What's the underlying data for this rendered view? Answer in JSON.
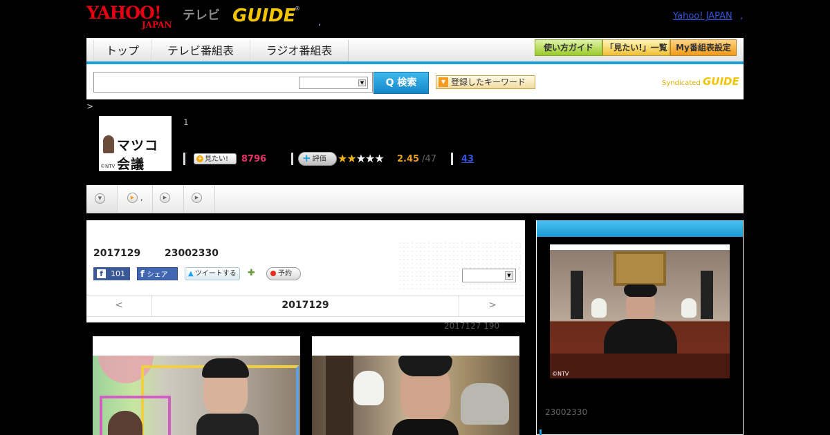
{
  "header": {
    "logo_yahoo_top": "YAHOO!",
    "logo_yahoo_bottom": "JAPAN",
    "logo_tv": "テレビ",
    "logo_gguide": "GUIDE",
    "header_dot": ",",
    "yahoo_japan_link": "Yahoo! JAPAN",
    "header_comma": ","
  },
  "nav": {
    "tabs": [
      {
        "label": "トップ"
      },
      {
        "label": "テレビ番組表"
      },
      {
        "label": "ラジオ番組表"
      }
    ],
    "buttons": {
      "guide": "使い方ガイド",
      "mitai_list": "「見たい!」一覧",
      "my_guide": "My番組表設定"
    }
  },
  "search": {
    "input_value": "",
    "button_label": "Q 検索",
    "keyword_button": "登録したキーワード",
    "syndicated_text": "Syndicated",
    "syndicated_logo": "GUIDE"
  },
  "breadcrumb": ">",
  "program": {
    "thumb_title": "マツコ会議",
    "thumb_copyright": "©NTV",
    "header_text": "1",
    "mitai_label": "見たい!",
    "mitai_count": "8796",
    "hyoka_label": "評価",
    "rating": 2.45,
    "rating_score": "2.45",
    "rating_count": "/47",
    "review_count": "43"
  },
  "subtabs": {
    "tab2_label": ","
  },
  "episode": {
    "date": "2017129",
    "time": "23002330",
    "like_count": "101",
    "share_label": "シェア",
    "tweet_label": "ツイートする",
    "reserve_label": "予約",
    "nav_prev": "<",
    "nav_date": "2017129",
    "nav_next": ">",
    "count_note": "2017127  190"
  },
  "panel": {
    "photo_copyright": "©NTV",
    "time": "23002330"
  },
  "colors": {
    "accent_blue": "#1aa0dc",
    "mitai_pink": "#e8326a",
    "star_orange": "#f2b21e",
    "yahoo_red": "#e60012",
    "gguide_yellow": "#f2c400"
  }
}
